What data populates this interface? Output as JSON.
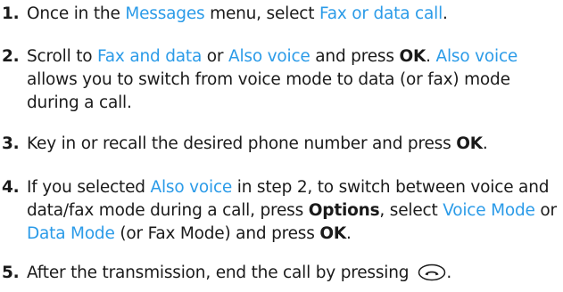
{
  "steps": [
    {
      "number": "1.",
      "t1": "Once in the ",
      "l1": "Messages",
      "t2": " menu, select ",
      "l2": "Fax or data call",
      "t3": "."
    },
    {
      "number": "2.",
      "t1": "Scroll to ",
      "l1": "Fax and data",
      "t2": " or ",
      "l2": "Also voice",
      "t3": " and press ",
      "b1": "OK",
      "t4": ". ",
      "l3": "Also voice",
      "t5": " allows you to switch from voice mode to data (or fax) mode during a call."
    },
    {
      "number": "3.",
      "t1": "Key in or recall the desired phone number and press ",
      "b1": "OK",
      "t2": "."
    },
    {
      "number": "4.",
      "t1": "If you selected ",
      "l1": "Also voice",
      "t2": " in step 2, to switch between voice and data/fax mode during a call, press ",
      "b1": "Options",
      "t3": ", select ",
      "l2": "Voice Mode",
      "t4": " or ",
      "l3": "Data Mode",
      "t5": " (or Fax Mode) and press ",
      "b2": "OK",
      "t6": "."
    },
    {
      "number": "5.",
      "t1": "After the transmission, end the call by pressing",
      "t2": ".",
      "icon": "end-call-key-icon"
    }
  ]
}
